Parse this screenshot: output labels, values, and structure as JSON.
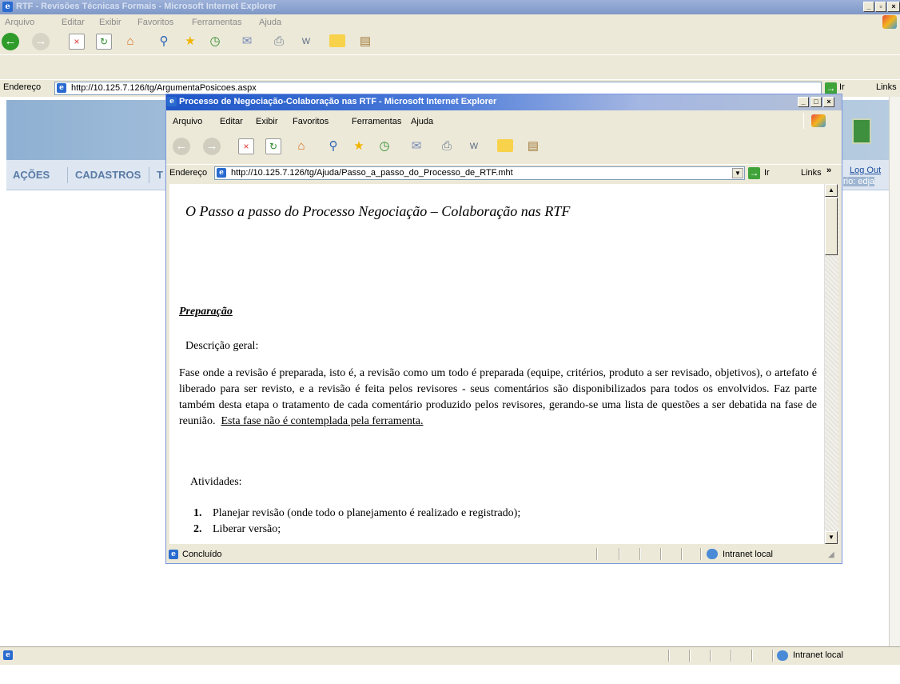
{
  "background_window": {
    "title": "RTF - Revisões Técnicas Formais - Microsoft Internet Explorer",
    "menu": [
      "Arquivo",
      "Editar",
      "Exibir",
      "Favoritos",
      "Ferramentas",
      "Ajuda"
    ],
    "address_label": "Endereço",
    "address_url": "http://10.125.7.126/tg/ArgumentaPosicoes.aspx",
    "go_label": "Ir",
    "links_label": "Links",
    "nav": [
      "AÇÕES",
      "CADASTROS",
      "T"
    ],
    "logout_label": "Log Out",
    "user_fragment": "rio: edja",
    "status_zone": "Intranet local"
  },
  "popup_window": {
    "title": "Processo de Negociação-Colaboração nas RTF - Microsoft Internet Explorer",
    "menu": [
      "Arquivo",
      "Editar",
      "Exibir",
      "Favoritos",
      "Ferramentas",
      "Ajuda"
    ],
    "address_label": "Endereço",
    "address_url": "http://10.125.7.126/tg/Ajuda/Passo_a_passo_do_Processo_de_RTF.mht",
    "go_label": "Ir",
    "links_label": "Links",
    "status_text": "Concluído",
    "status_zone": "Intranet local"
  },
  "document": {
    "title": "O Passo a passo do Processo Negociação – Colaboração nas RTF",
    "section": "Preparação",
    "general_label": "Descrição geral:",
    "paragraph": "Fase onde a revisão é preparada, isto é, a revisão como um todo é preparada (equipe, critérios, produto a ser revisado, objetivos), o artefato é liberado para ser revisto, e a revisão é feita pelos revisores - seus comentários são disponibilizados para todos os envolvidos. Faz parte também desta etapa o tratamento de cada comentário produzido pelos revisores, gerando-se uma lista de questões a ser debatida na fase de reunião.",
    "paragraph_underlined": "Esta fase não é contemplada pela ferramenta.",
    "activities_label": "Atividades:",
    "activities": [
      {
        "num": "1.",
        "text": "Planejar revisão (onde todo o planejamento é realizado e registrado);"
      },
      {
        "num": "2.",
        "text": "Liberar versão;"
      }
    ]
  }
}
